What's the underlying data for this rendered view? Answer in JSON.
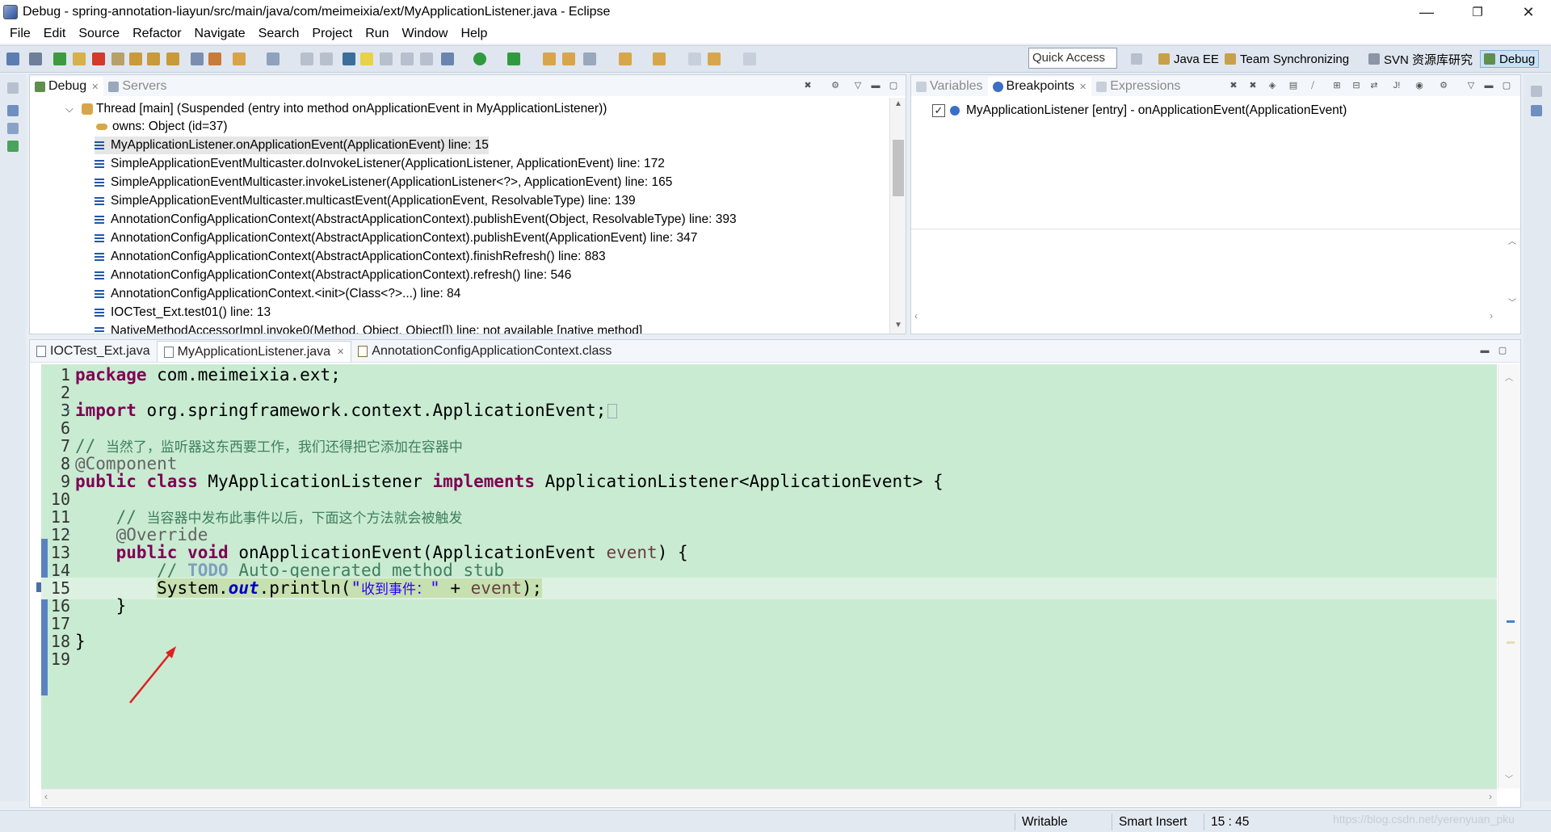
{
  "window": {
    "title": "Debug - spring-annotation-liayun/src/main/java/com/meimeixia/ext/MyApplicationListener.java - Eclipse",
    "minimize_glyph": "—",
    "restore_glyph": "❐",
    "close_glyph": "✕"
  },
  "menu": [
    "File",
    "Edit",
    "Source",
    "Refactor",
    "Navigate",
    "Search",
    "Project",
    "Run",
    "Window",
    "Help"
  ],
  "toolbar": {
    "quick_access": "Quick Access",
    "perspectives": [
      {
        "label": "Java EE",
        "icon": "java-ee-perspective-icon"
      },
      {
        "label": "Team Synchronizing",
        "icon": "team-sync-perspective-icon"
      },
      {
        "label": "SVN 资源库研究",
        "icon": "svn-perspective-icon"
      },
      {
        "label": "Debug",
        "icon": "debug-perspective-icon",
        "active": true
      }
    ]
  },
  "debug_view": {
    "tabs": [
      {
        "label": "Debug",
        "icon": "debug-bug-icon",
        "active": true
      },
      {
        "label": "Servers",
        "icon": "servers-icon",
        "active": false
      }
    ],
    "thread": "Thread [main] (Suspended (entry into method onApplicationEvent in MyApplicationListener))",
    "owns": "owns: Object  (id=37)",
    "frames": [
      "MyApplicationListener.onApplicationEvent(ApplicationEvent) line: 15",
      "SimpleApplicationEventMulticaster.doInvokeListener(ApplicationListener, ApplicationEvent) line: 172",
      "SimpleApplicationEventMulticaster.invokeListener(ApplicationListener<?>, ApplicationEvent) line: 165",
      "SimpleApplicationEventMulticaster.multicastEvent(ApplicationEvent, ResolvableType) line: 139",
      "AnnotationConfigApplicationContext(AbstractApplicationContext).publishEvent(Object, ResolvableType) line: 393",
      "AnnotationConfigApplicationContext(AbstractApplicationContext).publishEvent(ApplicationEvent) line: 347",
      "AnnotationConfigApplicationContext(AbstractApplicationContext).finishRefresh() line: 883",
      "AnnotationConfigApplicationContext(AbstractApplicationContext).refresh() line: 546",
      "AnnotationConfigApplicationContext.<init>(Class<?>...) line: 84",
      "IOCTest_Ext.test01() line: 13",
      "NativeMethodAccessorImpl.invoke0(Method, Object, Object[]) line: not available [native method]"
    ]
  },
  "breakpoints_view": {
    "tabs": [
      {
        "label": "Variables",
        "icon": "variables-icon",
        "active": false
      },
      {
        "label": "Breakpoints",
        "icon": "breakpoints-icon",
        "active": true
      },
      {
        "label": "Expressions",
        "icon": "expressions-icon",
        "active": false
      }
    ],
    "items": [
      {
        "label": "MyApplicationListener [entry] - onApplicationEvent(ApplicationEvent)",
        "checked": true
      }
    ]
  },
  "editor": {
    "tabs": [
      {
        "label": "IOCTest_Ext.java",
        "active": false
      },
      {
        "label": "MyApplicationListener.java",
        "active": true
      },
      {
        "label": "AnnotationConfigApplicationContext.class",
        "active": false
      }
    ],
    "current_line": "15",
    "lines": [
      {
        "n": "1"
      },
      {
        "n": "2"
      },
      {
        "n": "3"
      },
      {
        "n": "6"
      },
      {
        "n": "7"
      },
      {
        "n": "8"
      },
      {
        "n": "9"
      },
      {
        "n": "10"
      },
      {
        "n": "11"
      },
      {
        "n": "12"
      },
      {
        "n": "13"
      },
      {
        "n": "14"
      },
      {
        "n": "15"
      },
      {
        "n": "16"
      },
      {
        "n": "17"
      },
      {
        "n": "18"
      },
      {
        "n": "19"
      }
    ],
    "code": {
      "l1_kw": "package",
      "l1_rest": " com.meimeixia.ext;",
      "l3_kw": "import",
      "l3_rest": " org.springframework.context.ApplicationEvent;",
      "l7_comment": "// ",
      "l7_cn": "当然了，监听器这东西要工作，我们还得把它添加在容器中",
      "l8_ann": "@Component",
      "l9_kw1": "public",
      "l9_kw2": "class",
      "l9_name": " MyApplicationListener ",
      "l9_kw3": "implements",
      "l9_rest": " ApplicationListener<ApplicationEvent> {",
      "l11_comment": "// ",
      "l11_cn": "当容器中发布此事件以后，下面这个方法就会被触发",
      "l12_ann": "@Override",
      "l13_kw1": "public",
      "l13_kw2": "void",
      "l13_rest": " onApplicationEvent(ApplicationEvent ",
      "l13_var": "event",
      "l13_end": ") {",
      "l14_comment_a": "// ",
      "l14_todo": "TODO",
      "l14_comment_b": " Auto-generated method stub",
      "l15_a": "System.",
      "l15_field": "out",
      "l15_b": ".println(",
      "l15_str_q": "\"",
      "l15_str_cn": "收到事件：",
      "l15_str_q2": "\"",
      "l15_c": " + ",
      "l15_var": "event",
      "l15_d": ");",
      "l16": "}",
      "l18": "}"
    }
  },
  "status": {
    "writable": "Writable",
    "insert_mode": "Smart Insert",
    "position": "15 : 45"
  },
  "watermark": "https://blog.csdn.net/yerenyuan_pku",
  "colors": {
    "editor_bg": "#c9ebd2",
    "keyword": "#7f0055",
    "comment": "#3f7f5f",
    "string": "#2a00ff",
    "annotation_arrow": "#e02020"
  }
}
